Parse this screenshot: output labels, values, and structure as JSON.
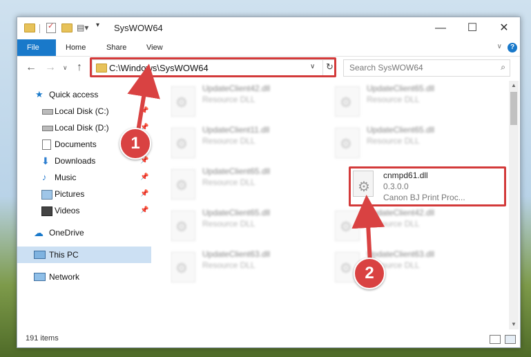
{
  "window": {
    "title": "SysWOW64",
    "controls": {
      "minimize": "—",
      "maximize": "☐",
      "close": "✕"
    }
  },
  "ribbon": {
    "tabs": [
      "File",
      "Home",
      "Share",
      "View"
    ],
    "help": "?"
  },
  "address": {
    "path": "C:\\Windows\\SysWOW64",
    "search_placeholder": "Search SysWOW64"
  },
  "sidebar": {
    "quick_access": "Quick access",
    "items": [
      {
        "label": "Local Disk (C:)",
        "icon": "drive-icon",
        "pinned": true
      },
      {
        "label": "Local Disk (D:)",
        "icon": "drive-icon",
        "pinned": true
      },
      {
        "label": "Documents",
        "icon": "documents-icon",
        "pinned": true
      },
      {
        "label": "Downloads",
        "icon": "downloads-icon",
        "pinned": true
      },
      {
        "label": "Music",
        "icon": "music-icon",
        "pinned": true
      },
      {
        "label": "Pictures",
        "icon": "pictures-icon",
        "pinned": true
      },
      {
        "label": "Videos",
        "icon": "videos-icon",
        "pinned": true
      }
    ],
    "onedrive": "OneDrive",
    "this_pc": "This PC",
    "network": "Network"
  },
  "files": {
    "blurred": [
      {
        "name": "UpdateClient42.dll",
        "type": "Resource DLL"
      },
      {
        "name": "UpdateClient65.dll",
        "type": "Resource DLL"
      },
      {
        "name": "UpdateClient11.dll",
        "type": "Resource DLL"
      },
      {
        "name": "UpdateClient65.dll",
        "type": "Resource DLL"
      },
      {
        "name": "UpdateClient65.dll",
        "type": "Resource DLL"
      },
      {
        "name": "UpdateClient65.dll",
        "type": "Resource DLL"
      },
      {
        "name": "UpdateClient42.dll",
        "type": "Resource DLL"
      },
      {
        "name": "UpdateClient63.dll",
        "type": "Resource DLL"
      },
      {
        "name": "UpdateClient63.dll",
        "type": "Resource DLL"
      }
    ],
    "highlighted": {
      "name": "cnmpd61.dll",
      "version": "0.3.0.0",
      "description": "Canon BJ Print Proc..."
    }
  },
  "status": {
    "items": "191 items"
  },
  "callouts": [
    "1",
    "2"
  ],
  "colors": {
    "accent": "#1979ca",
    "highlight": "#d33a3a",
    "selected": "#cce0f3"
  }
}
